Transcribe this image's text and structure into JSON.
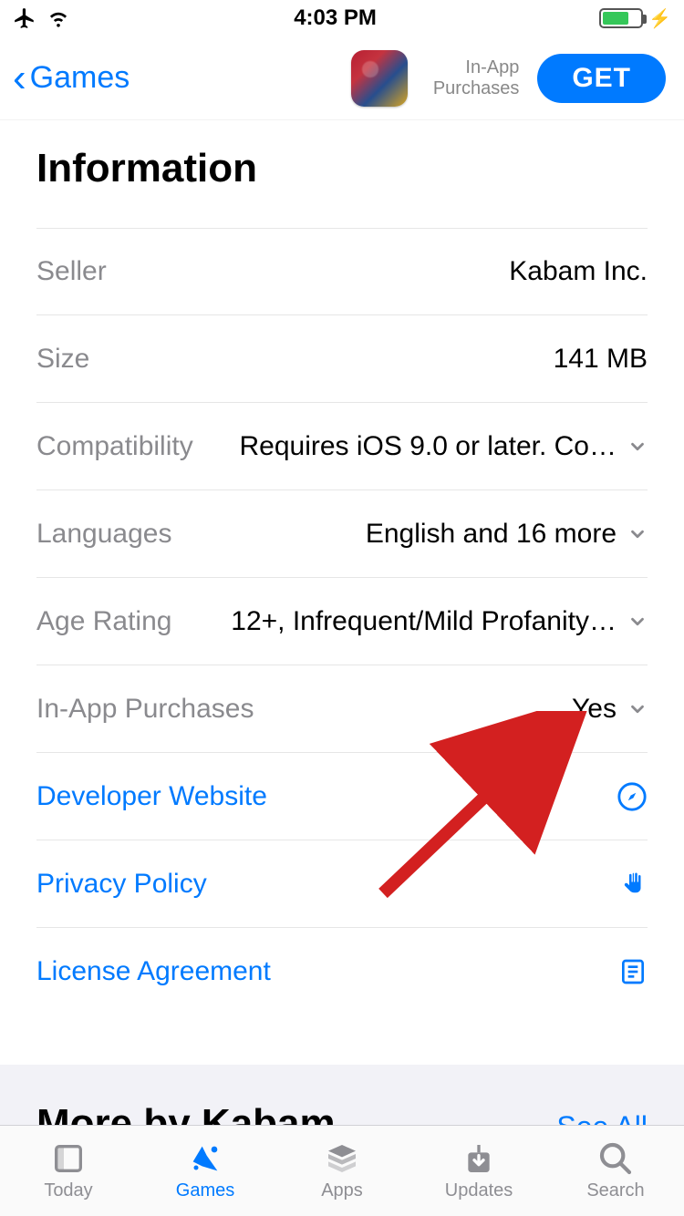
{
  "status": {
    "time": "4:03 PM"
  },
  "nav": {
    "back_label": "Games",
    "iap_note_line1": "In-App",
    "iap_note_line2": "Purchases",
    "get_label": "GET"
  },
  "section_title": "Information",
  "rows": [
    {
      "label": "Seller",
      "value": "Kabam Inc.",
      "expandable": false
    },
    {
      "label": "Size",
      "value": "141 MB",
      "expandable": false
    },
    {
      "label": "Compatibility",
      "value": "Requires iOS 9.0 or later. Co…",
      "expandable": true
    },
    {
      "label": "Languages",
      "value": "English and 16 more",
      "expandable": true
    },
    {
      "label": "Age Rating",
      "value": "12+, Infrequent/Mild Profanity…",
      "expandable": true
    },
    {
      "label": "In-App Purchases",
      "value": "Yes",
      "expandable": true
    }
  ],
  "links": {
    "developer_website": "Developer Website",
    "privacy_policy": "Privacy Policy",
    "license_agreement": "License Agreement"
  },
  "more_by": {
    "title": "More by Kabam",
    "see_all": "See All"
  },
  "tabs": {
    "today": "Today",
    "games": "Games",
    "apps": "Apps",
    "updates": "Updates",
    "search": "Search"
  }
}
